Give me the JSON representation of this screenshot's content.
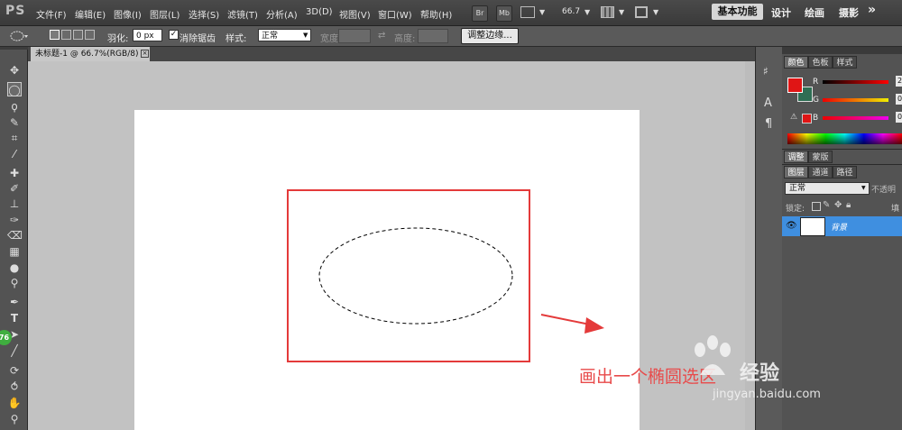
{
  "app": {
    "logo": "PS"
  },
  "menus": [
    "文件(F)",
    "编辑(E)",
    "图像(I)",
    "图层(L)",
    "选择(S)",
    "滤镜(T)",
    "分析(A)",
    "3D(D)",
    "视图(V)",
    "窗口(W)",
    "帮助(H)"
  ],
  "menubar_buttons": {
    "bridge": "Br",
    "mini_bridge": "Mb",
    "zoom": "66.7"
  },
  "workspaces": {
    "active": "基本功能",
    "items": [
      "设计",
      "绘画",
      "摄影"
    ],
    "more": "»"
  },
  "options_bar": {
    "feather_label": "羽化:",
    "feather_value": "0 px",
    "antialias_label": "消除锯齿",
    "antialias_checked": true,
    "style_label": "样式:",
    "style_value": "正常",
    "width_label": "宽度:",
    "height_label": "高度:",
    "refine_edge_button": "调整边缘..."
  },
  "document": {
    "tab_title": "未标题-1 @ 66.7%(RGB/8)",
    "annotation_text": "画出一个椭圆选区",
    "frame_color": "#e43a3a",
    "arrow_color": "#e43a3a"
  },
  "toolbox": {
    "badge": "76"
  },
  "color_panel": {
    "tabs": [
      "颜色",
      "色板",
      "样式"
    ],
    "foreground": "#e01515",
    "background": "#2f6e54",
    "sliders": [
      {
        "label": "R",
        "value": "2"
      },
      {
        "label": "G",
        "value": "0"
      },
      {
        "label": "B",
        "value": "0"
      }
    ]
  },
  "adjust_panel": {
    "tabs": [
      "调整",
      "蒙版"
    ]
  },
  "layers_panel": {
    "tabs": [
      "图层",
      "通道",
      "路径"
    ],
    "blend_mode": "正常",
    "opacity_label": "不透明",
    "lock_label": "锁定:",
    "fill_label": "填",
    "layer_name": "背景",
    "selected_color": "#3f8fe0"
  },
  "side_strip": {
    "char_icon": "A",
    "para_icon": "¶"
  },
  "watermark": {
    "brand": "Baidu",
    "text": "经验",
    "url": "jingyan.baidu.com"
  }
}
